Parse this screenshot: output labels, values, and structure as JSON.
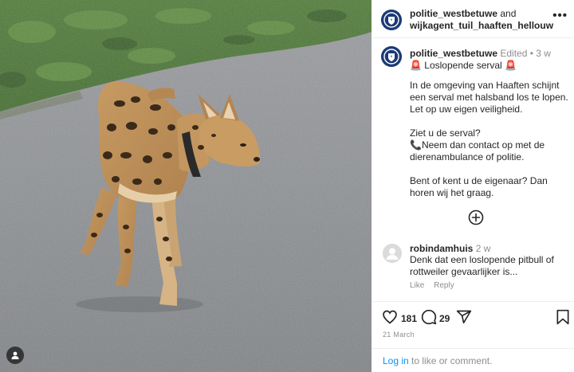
{
  "header": {
    "user1": "politie_westbetuwe",
    "conjunction": "and",
    "user2": "wijkagent_tuil_haaften_hellouw",
    "more_label": "•••"
  },
  "caption": {
    "username": "politie_westbetuwe",
    "edited": "Edited",
    "separator": "•",
    "time": "3 w",
    "title_emoji_left": "🚨",
    "title": "Loslopende serval",
    "title_emoji_right": "🚨",
    "paragraph1": "In de omgeving van Haaften schijnt een serval met halsband los te lopen. Let op uw eigen veiligheid.",
    "paragraph2_line1": "Ziet u de serval?",
    "paragraph2_emoji": "📞",
    "paragraph2_line2": "Neem dan contact op met de dierenambulance of politie.",
    "paragraph3": "Bent of kent u de eigenaar? Dan horen wij het graag."
  },
  "add_comment_icon": "plus-circle-icon",
  "comment": {
    "username": "robindamhuis",
    "time": "2 w",
    "text": "Denk dat een loslopende pitbull of rottweiler gevaarlijker is...",
    "like_label": "Like",
    "reply_label": "Reply"
  },
  "actions": {
    "likes": "181",
    "comments": "29",
    "date": "21 March"
  },
  "login": {
    "link": "Log in",
    "rest": " to like or comment."
  },
  "colors": {
    "link_blue": "#0095f6",
    "police_blue": "#1b3a75",
    "muted": "#8e8e8e",
    "text": "#262626"
  }
}
